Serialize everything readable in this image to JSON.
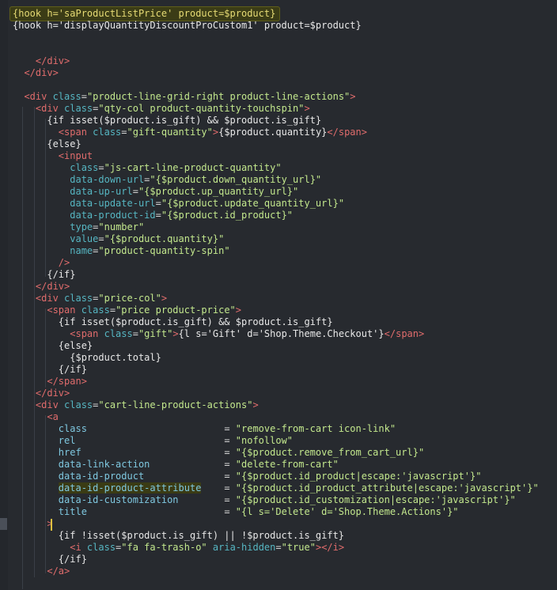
{
  "editor": {
    "lines": [
      [
        {
          "t": "{hook h='saProductListPrice' product=$product}",
          "c": "yellow"
        }
      ],
      [
        {
          "t": "{hook h='displayQuantityDiscountProCustom1' product=$product}",
          "c": "brace"
        }
      ],
      [
        {
          "t": "",
          "c": "plain"
        }
      ],
      [
        {
          "t": "",
          "c": "plain"
        }
      ],
      [
        {
          "t": "    </div>",
          "c": "tag"
        }
      ],
      [
        {
          "t": "  </div>",
          "c": "tag"
        }
      ],
      [
        {
          "t": "",
          "c": "plain"
        }
      ],
      [
        {
          "t": "  <div ",
          "c": "tag"
        },
        {
          "t": "class",
          "c": "attr"
        },
        {
          "t": "=",
          "c": "op"
        },
        {
          "t": "\"product-line-grid-right product-line-actions\"",
          "c": "str"
        },
        {
          "t": ">",
          "c": "tag"
        }
      ],
      [
        {
          "t": "    <div ",
          "c": "tag"
        },
        {
          "t": "class",
          "c": "attr"
        },
        {
          "t": "=",
          "c": "op"
        },
        {
          "t": "\"qty-col product-quantity-touchspin\"",
          "c": "str"
        },
        {
          "t": ">",
          "c": "tag"
        }
      ],
      [
        {
          "t": "      {if isset($product.is_gift) && $product.is_gift}",
          "c": "brace"
        }
      ],
      [
        {
          "t": "        <span ",
          "c": "tag"
        },
        {
          "t": "class",
          "c": "attr"
        },
        {
          "t": "=",
          "c": "op"
        },
        {
          "t": "\"gift-quantity\"",
          "c": "str"
        },
        {
          "t": ">",
          "c": "tag"
        },
        {
          "t": "{$product.quantity}",
          "c": "brace"
        },
        {
          "t": "</span>",
          "c": "tag"
        }
      ],
      [
        {
          "t": "      {else}",
          "c": "brace"
        }
      ],
      [
        {
          "t": "        <input",
          "c": "tag"
        }
      ],
      [
        {
          "t": "          class",
          "c": "attr"
        },
        {
          "t": "=",
          "c": "op"
        },
        {
          "t": "\"js-cart-line-product-quantity\"",
          "c": "str"
        }
      ],
      [
        {
          "t": "          data-down-url",
          "c": "attr"
        },
        {
          "t": "=",
          "c": "op"
        },
        {
          "t": "\"{$product.down_quantity_url}\"",
          "c": "str"
        }
      ],
      [
        {
          "t": "          data-up-url",
          "c": "attr"
        },
        {
          "t": "=",
          "c": "op"
        },
        {
          "t": "\"{$product.up_quantity_url}\"",
          "c": "str"
        }
      ],
      [
        {
          "t": "          data-update-url",
          "c": "attr"
        },
        {
          "t": "=",
          "c": "op"
        },
        {
          "t": "\"{$product.update_quantity_url}\"",
          "c": "str"
        }
      ],
      [
        {
          "t": "          data-product-id",
          "c": "attr"
        },
        {
          "t": "=",
          "c": "op"
        },
        {
          "t": "\"{$product.id_product}\"",
          "c": "str"
        }
      ],
      [
        {
          "t": "          type",
          "c": "attr"
        },
        {
          "t": "=",
          "c": "op"
        },
        {
          "t": "\"number\"",
          "c": "str"
        }
      ],
      [
        {
          "t": "          value",
          "c": "attr"
        },
        {
          "t": "=",
          "c": "op"
        },
        {
          "t": "\"{$product.quantity}\"",
          "c": "str"
        }
      ],
      [
        {
          "t": "          name",
          "c": "attr"
        },
        {
          "t": "=",
          "c": "op"
        },
        {
          "t": "\"product-quantity-spin\"",
          "c": "str"
        }
      ],
      [
        {
          "t": "        />",
          "c": "tag"
        }
      ],
      [
        {
          "t": "      {/if}",
          "c": "brace"
        }
      ],
      [
        {
          "t": "    </div>",
          "c": "tag"
        }
      ],
      [
        {
          "t": "    <div ",
          "c": "tag"
        },
        {
          "t": "class",
          "c": "attr"
        },
        {
          "t": "=",
          "c": "op"
        },
        {
          "t": "\"price-col\"",
          "c": "str"
        },
        {
          "t": ">",
          "c": "tag"
        }
      ],
      [
        {
          "t": "      <span ",
          "c": "tag"
        },
        {
          "t": "class",
          "c": "attr"
        },
        {
          "t": "=",
          "c": "op"
        },
        {
          "t": "\"price product-price\"",
          "c": "str"
        },
        {
          "t": ">",
          "c": "tag"
        }
      ],
      [
        {
          "t": "        {if isset($product.is_gift) && $product.is_gift}",
          "c": "brace"
        }
      ],
      [
        {
          "t": "          <span ",
          "c": "tag"
        },
        {
          "t": "class",
          "c": "attr"
        },
        {
          "t": "=",
          "c": "op"
        },
        {
          "t": "\"gift\"",
          "c": "str"
        },
        {
          "t": ">",
          "c": "tag"
        },
        {
          "t": "{l s='Gift' d='Shop.Theme.Checkout'}",
          "c": "brace"
        },
        {
          "t": "</span>",
          "c": "tag"
        }
      ],
      [
        {
          "t": "        {else}",
          "c": "brace"
        }
      ],
      [
        {
          "t": "          {$product.total}",
          "c": "brace"
        }
      ],
      [
        {
          "t": "        {/if}",
          "c": "brace"
        }
      ],
      [
        {
          "t": "      </span>",
          "c": "tag"
        }
      ],
      [
        {
          "t": "    </div>",
          "c": "tag"
        }
      ],
      [
        {
          "t": "    <div ",
          "c": "tag"
        },
        {
          "t": "class",
          "c": "attr"
        },
        {
          "t": "=",
          "c": "op"
        },
        {
          "t": "\"cart-line-product-actions\"",
          "c": "str"
        },
        {
          "t": ">",
          "c": "tag"
        }
      ],
      [
        {
          "t": "      <a",
          "c": "tag"
        }
      ],
      [
        {
          "t": "        class                        ",
          "c": "attr2"
        },
        {
          "t": "= ",
          "c": "op"
        },
        {
          "t": "\"remove-from-cart icon-link\"",
          "c": "str"
        }
      ],
      [
        {
          "t": "        rel                          ",
          "c": "attr2"
        },
        {
          "t": "= ",
          "c": "op"
        },
        {
          "t": "\"nofollow\"",
          "c": "str"
        }
      ],
      [
        {
          "t": "        href                         ",
          "c": "attr2"
        },
        {
          "t": "= ",
          "c": "op"
        },
        {
          "t": "\"{$product.remove_from_cart_url}\"",
          "c": "str"
        }
      ],
      [
        {
          "t": "        data-link-action             ",
          "c": "attr2"
        },
        {
          "t": "= ",
          "c": "op"
        },
        {
          "t": "\"delete-from-cart\"",
          "c": "str"
        }
      ],
      [
        {
          "t": "        data-id-product              ",
          "c": "attr2"
        },
        {
          "t": "= ",
          "c": "op"
        },
        {
          "t": "\"{$product.id_product|escape:'javascript'}\"",
          "c": "str"
        }
      ],
      [
        {
          "t": "        ",
          "c": "attr2"
        },
        {
          "t": "data-id-product-attribute",
          "c": "attr2",
          "hl": true
        },
        {
          "t": "    ",
          "c": "attr2"
        },
        {
          "t": "= ",
          "c": "op"
        },
        {
          "t": "\"{$product.id_product_attribute|escape:'javascript'}\"",
          "c": "str"
        }
      ],
      [
        {
          "t": "        data-id-customization        ",
          "c": "attr2"
        },
        {
          "t": "= ",
          "c": "op"
        },
        {
          "t": "\"{$product.id_customization|escape:'javascript'}\"",
          "c": "str"
        }
      ],
      [
        {
          "t": "        title                        ",
          "c": "attr2"
        },
        {
          "t": "= ",
          "c": "op"
        },
        {
          "t": "\"{l s='Delete' d='Shop.Theme.Actions'}\"",
          "c": "str"
        }
      ],
      [
        {
          "t": "      >",
          "c": "tag"
        }
      ],
      [
        {
          "t": "        {if !isset($product.is_gift) || !$product.is_gift}",
          "c": "brace"
        }
      ],
      [
        {
          "t": "          <i ",
          "c": "tag"
        },
        {
          "t": "class",
          "c": "attr"
        },
        {
          "t": "=",
          "c": "op"
        },
        {
          "t": "\"fa fa-trash-o\"",
          "c": "str"
        },
        {
          "t": " ",
          "c": "plain"
        },
        {
          "t": "aria-hidden",
          "c": "attr"
        },
        {
          "t": "=",
          "c": "op"
        },
        {
          "t": "\"true\"",
          "c": "str"
        },
        {
          "t": "></i>",
          "c": "tag"
        }
      ],
      [
        {
          "t": "        {/if}",
          "c": "brace"
        }
      ],
      [
        {
          "t": "      </a>",
          "c": "tag"
        }
      ]
    ]
  }
}
